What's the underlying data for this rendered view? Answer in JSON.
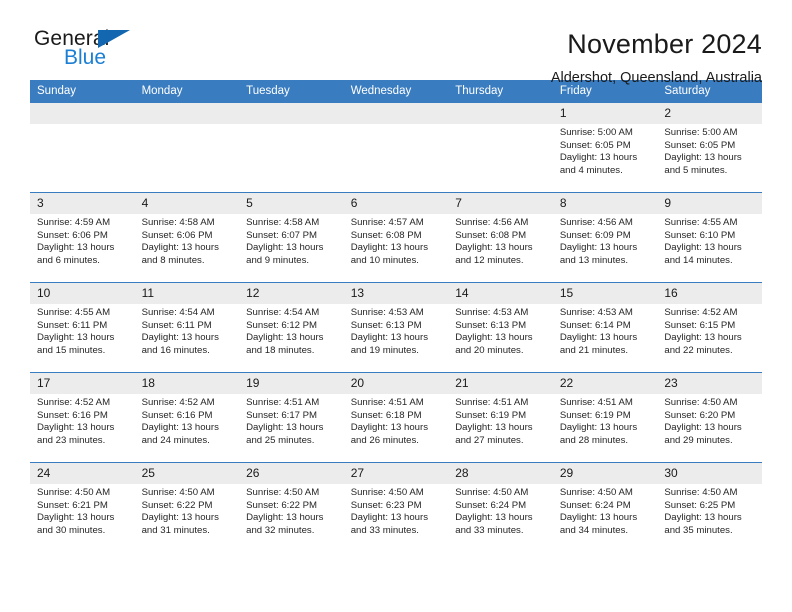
{
  "brand": {
    "name_part1": "General",
    "name_part2": "Blue",
    "flag_icon": "triangle-flag-icon"
  },
  "header": {
    "title": "November 2024",
    "subtitle": "Aldershot, Queensland, Australia"
  },
  "calendar": {
    "weekday_headers": [
      "Sunday",
      "Monday",
      "Tuesday",
      "Wednesday",
      "Thursday",
      "Friday",
      "Saturday"
    ],
    "accent_color": "#3a7cc0",
    "daynum_bg": "#ececec",
    "weeks": [
      [
        {
          "day": "",
          "empty": true
        },
        {
          "day": "",
          "empty": true
        },
        {
          "day": "",
          "empty": true
        },
        {
          "day": "",
          "empty": true
        },
        {
          "day": "",
          "empty": true
        },
        {
          "day": "1",
          "sunrise": "Sunrise: 5:00 AM",
          "sunset": "Sunset: 6:05 PM",
          "daylight": "Daylight: 13 hours and 4 minutes."
        },
        {
          "day": "2",
          "sunrise": "Sunrise: 5:00 AM",
          "sunset": "Sunset: 6:05 PM",
          "daylight": "Daylight: 13 hours and 5 minutes."
        }
      ],
      [
        {
          "day": "3",
          "sunrise": "Sunrise: 4:59 AM",
          "sunset": "Sunset: 6:06 PM",
          "daylight": "Daylight: 13 hours and 6 minutes."
        },
        {
          "day": "4",
          "sunrise": "Sunrise: 4:58 AM",
          "sunset": "Sunset: 6:06 PM",
          "daylight": "Daylight: 13 hours and 8 minutes."
        },
        {
          "day": "5",
          "sunrise": "Sunrise: 4:58 AM",
          "sunset": "Sunset: 6:07 PM",
          "daylight": "Daylight: 13 hours and 9 minutes."
        },
        {
          "day": "6",
          "sunrise": "Sunrise: 4:57 AM",
          "sunset": "Sunset: 6:08 PM",
          "daylight": "Daylight: 13 hours and 10 minutes."
        },
        {
          "day": "7",
          "sunrise": "Sunrise: 4:56 AM",
          "sunset": "Sunset: 6:08 PM",
          "daylight": "Daylight: 13 hours and 12 minutes."
        },
        {
          "day": "8",
          "sunrise": "Sunrise: 4:56 AM",
          "sunset": "Sunset: 6:09 PM",
          "daylight": "Daylight: 13 hours and 13 minutes."
        },
        {
          "day": "9",
          "sunrise": "Sunrise: 4:55 AM",
          "sunset": "Sunset: 6:10 PM",
          "daylight": "Daylight: 13 hours and 14 minutes."
        }
      ],
      [
        {
          "day": "10",
          "sunrise": "Sunrise: 4:55 AM",
          "sunset": "Sunset: 6:11 PM",
          "daylight": "Daylight: 13 hours and 15 minutes."
        },
        {
          "day": "11",
          "sunrise": "Sunrise: 4:54 AM",
          "sunset": "Sunset: 6:11 PM",
          "daylight": "Daylight: 13 hours and 16 minutes."
        },
        {
          "day": "12",
          "sunrise": "Sunrise: 4:54 AM",
          "sunset": "Sunset: 6:12 PM",
          "daylight": "Daylight: 13 hours and 18 minutes."
        },
        {
          "day": "13",
          "sunrise": "Sunrise: 4:53 AM",
          "sunset": "Sunset: 6:13 PM",
          "daylight": "Daylight: 13 hours and 19 minutes."
        },
        {
          "day": "14",
          "sunrise": "Sunrise: 4:53 AM",
          "sunset": "Sunset: 6:13 PM",
          "daylight": "Daylight: 13 hours and 20 minutes."
        },
        {
          "day": "15",
          "sunrise": "Sunrise: 4:53 AM",
          "sunset": "Sunset: 6:14 PM",
          "daylight": "Daylight: 13 hours and 21 minutes."
        },
        {
          "day": "16",
          "sunrise": "Sunrise: 4:52 AM",
          "sunset": "Sunset: 6:15 PM",
          "daylight": "Daylight: 13 hours and 22 minutes."
        }
      ],
      [
        {
          "day": "17",
          "sunrise": "Sunrise: 4:52 AM",
          "sunset": "Sunset: 6:16 PM",
          "daylight": "Daylight: 13 hours and 23 minutes."
        },
        {
          "day": "18",
          "sunrise": "Sunrise: 4:52 AM",
          "sunset": "Sunset: 6:16 PM",
          "daylight": "Daylight: 13 hours and 24 minutes."
        },
        {
          "day": "19",
          "sunrise": "Sunrise: 4:51 AM",
          "sunset": "Sunset: 6:17 PM",
          "daylight": "Daylight: 13 hours and 25 minutes."
        },
        {
          "day": "20",
          "sunrise": "Sunrise: 4:51 AM",
          "sunset": "Sunset: 6:18 PM",
          "daylight": "Daylight: 13 hours and 26 minutes."
        },
        {
          "day": "21",
          "sunrise": "Sunrise: 4:51 AM",
          "sunset": "Sunset: 6:19 PM",
          "daylight": "Daylight: 13 hours and 27 minutes."
        },
        {
          "day": "22",
          "sunrise": "Sunrise: 4:51 AM",
          "sunset": "Sunset: 6:19 PM",
          "daylight": "Daylight: 13 hours and 28 minutes."
        },
        {
          "day": "23",
          "sunrise": "Sunrise: 4:50 AM",
          "sunset": "Sunset: 6:20 PM",
          "daylight": "Daylight: 13 hours and 29 minutes."
        }
      ],
      [
        {
          "day": "24",
          "sunrise": "Sunrise: 4:50 AM",
          "sunset": "Sunset: 6:21 PM",
          "daylight": "Daylight: 13 hours and 30 minutes."
        },
        {
          "day": "25",
          "sunrise": "Sunrise: 4:50 AM",
          "sunset": "Sunset: 6:22 PM",
          "daylight": "Daylight: 13 hours and 31 minutes."
        },
        {
          "day": "26",
          "sunrise": "Sunrise: 4:50 AM",
          "sunset": "Sunset: 6:22 PM",
          "daylight": "Daylight: 13 hours and 32 minutes."
        },
        {
          "day": "27",
          "sunrise": "Sunrise: 4:50 AM",
          "sunset": "Sunset: 6:23 PM",
          "daylight": "Daylight: 13 hours and 33 minutes."
        },
        {
          "day": "28",
          "sunrise": "Sunrise: 4:50 AM",
          "sunset": "Sunset: 6:24 PM",
          "daylight": "Daylight: 13 hours and 33 minutes."
        },
        {
          "day": "29",
          "sunrise": "Sunrise: 4:50 AM",
          "sunset": "Sunset: 6:24 PM",
          "daylight": "Daylight: 13 hours and 34 minutes."
        },
        {
          "day": "30",
          "sunrise": "Sunrise: 4:50 AM",
          "sunset": "Sunset: 6:25 PM",
          "daylight": "Daylight: 13 hours and 35 minutes."
        }
      ]
    ]
  }
}
